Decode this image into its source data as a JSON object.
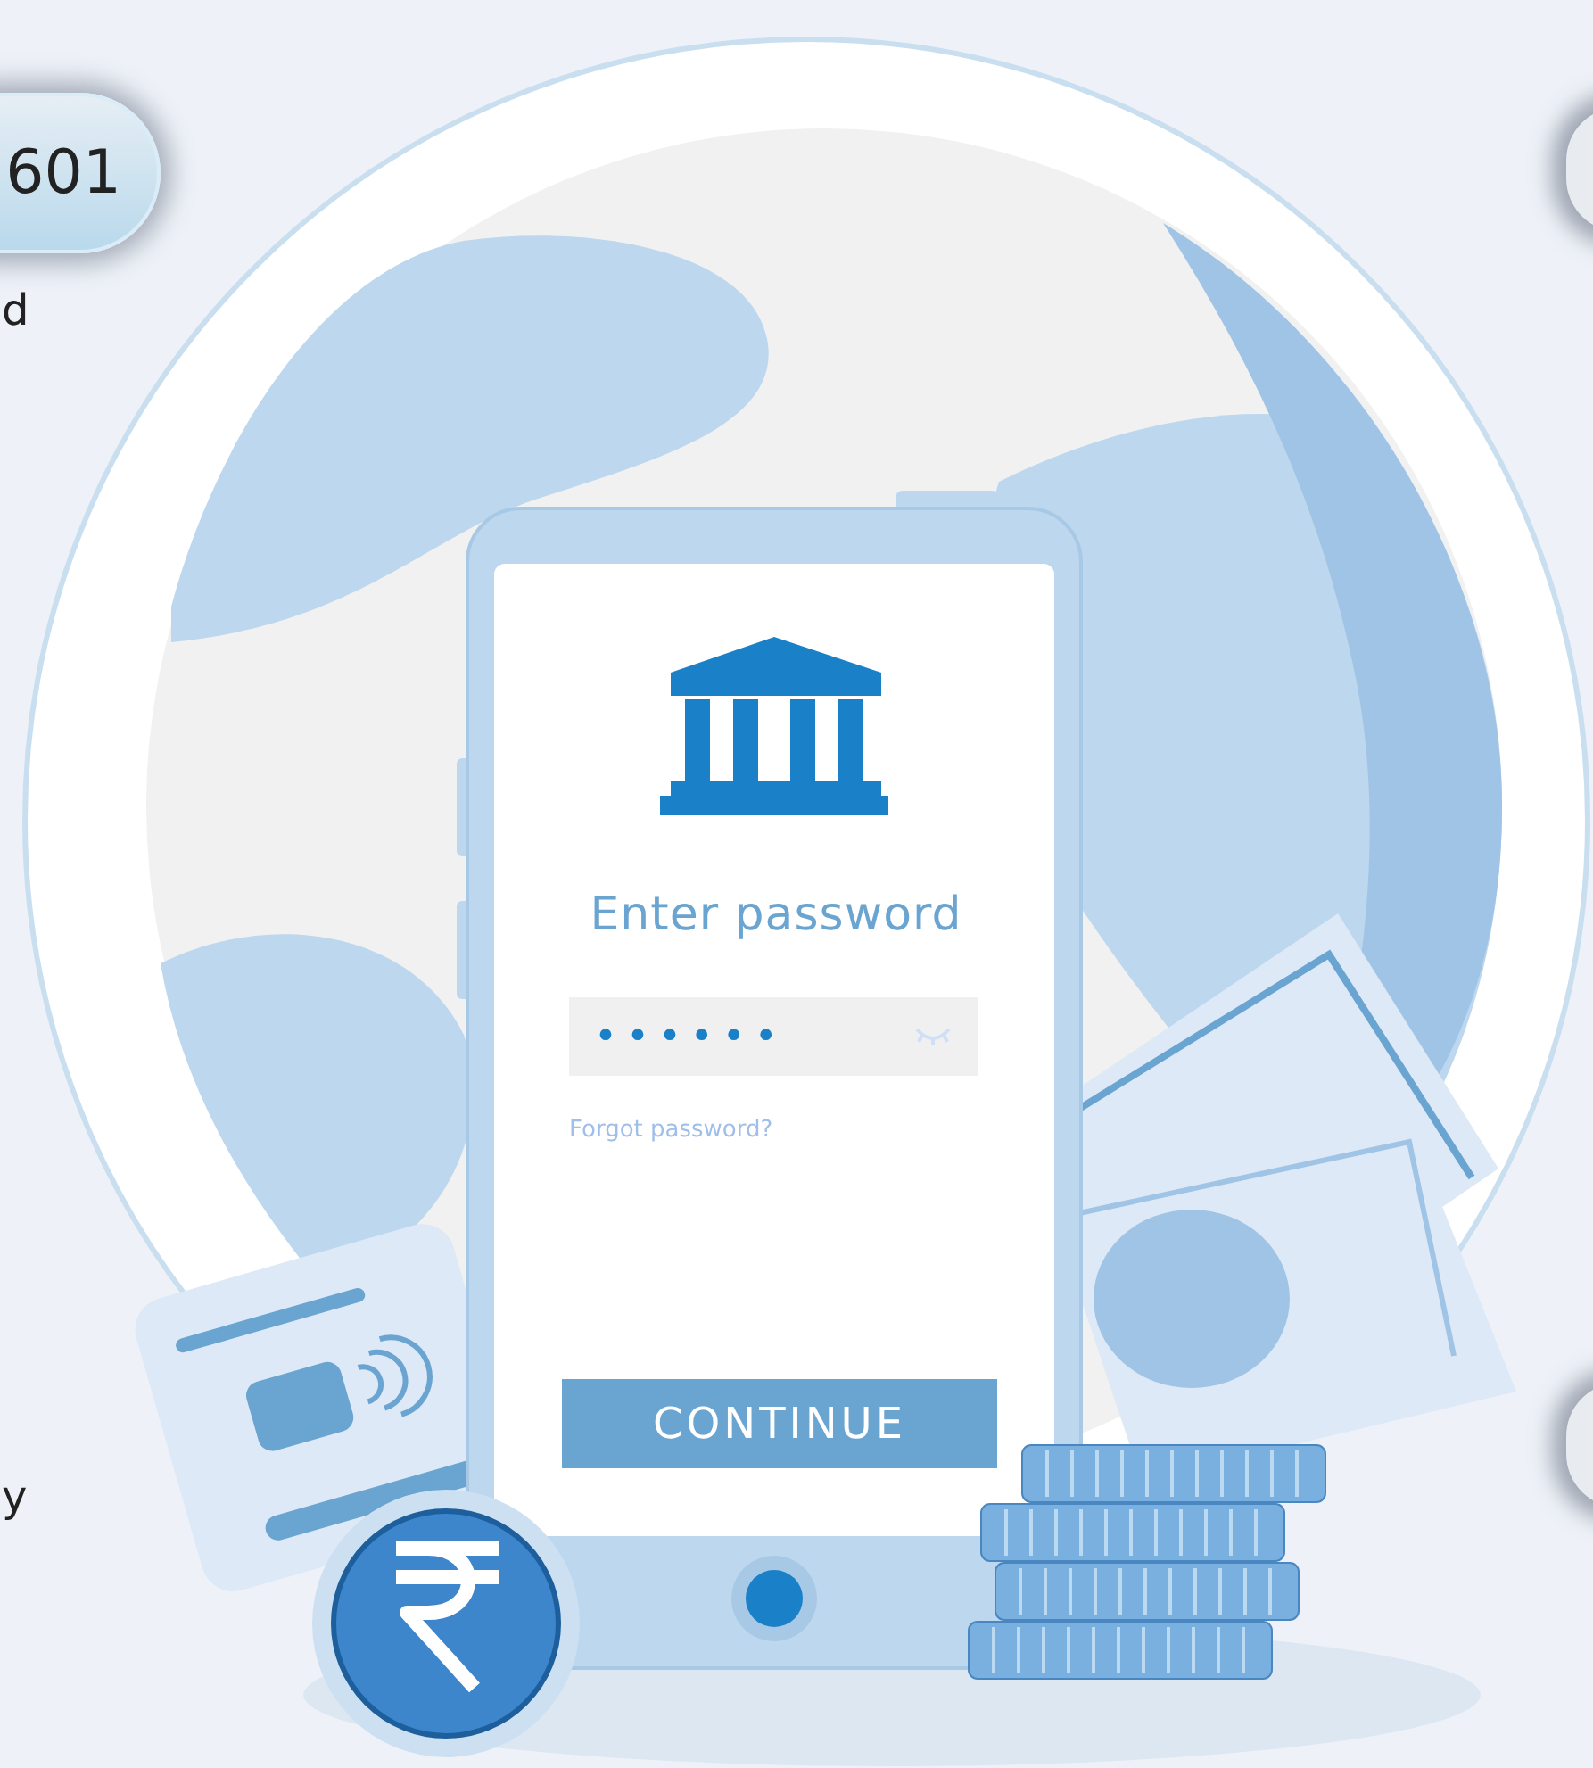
{
  "badge": {
    "label": "601"
  },
  "side_texts": [
    {
      "text": "d"
    },
    {
      "text": "y"
    }
  ],
  "login": {
    "title": "Enter password",
    "password_field": {
      "value": "••••••"
    },
    "forgot_link": "Forgot password?",
    "continue_button": "CONTINUE"
  }
}
